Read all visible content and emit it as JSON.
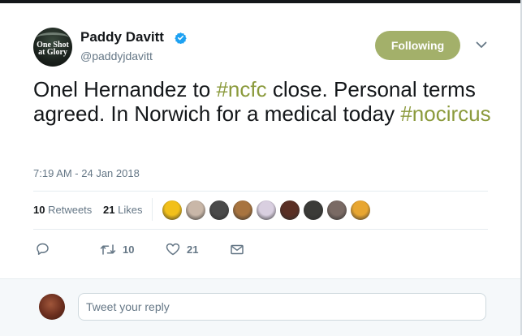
{
  "author": {
    "name": "Paddy Davitt",
    "handle": "@paddyjdavitt",
    "avatar_text": "One Shot\nat Glory",
    "verified": true
  },
  "follow_button": {
    "label": "Following",
    "color": "#a3b06a"
  },
  "tweet": {
    "parts": [
      {
        "text": "Onel Hernandez to ",
        "hashtag": false
      },
      {
        "text": "#ncfc",
        "hashtag": true
      },
      {
        "text": " close. Personal terms agreed. In Norwich for a medical today ",
        "hashtag": false
      },
      {
        "text": "#nocircus",
        "hashtag": true
      }
    ],
    "hashtag_color": "#8b9a3c",
    "timestamp": "7:19 AM - 24 Jan 2018"
  },
  "stats": {
    "retweets_count": "10",
    "retweets_label": "Retweets",
    "likes_count": "21",
    "likes_label": "Likes"
  },
  "liker_avatars": [
    {
      "name": "liker-avatar-1",
      "color": "#f2c01a"
    },
    {
      "name": "liker-avatar-2",
      "color": "#c9b7a8"
    },
    {
      "name": "liker-avatar-3",
      "color": "#4a4a4a"
    },
    {
      "name": "liker-avatar-4",
      "color": "#a8743f"
    },
    {
      "name": "liker-avatar-5",
      "color": "#d9cfe0"
    },
    {
      "name": "liker-avatar-6",
      "color": "#5a2f24"
    },
    {
      "name": "liker-avatar-7",
      "color": "#3b3b38"
    },
    {
      "name": "liker-avatar-8",
      "color": "#7a6a64"
    },
    {
      "name": "liker-avatar-9",
      "color": "#e8a630"
    }
  ],
  "actions": {
    "reply_icon": "reply-icon",
    "retweet_icon": "retweet-icon",
    "retweet_count": "10",
    "like_icon": "heart-icon",
    "like_count": "21",
    "dm_icon": "envelope-icon"
  },
  "reply": {
    "placeholder": "Tweet your reply"
  }
}
